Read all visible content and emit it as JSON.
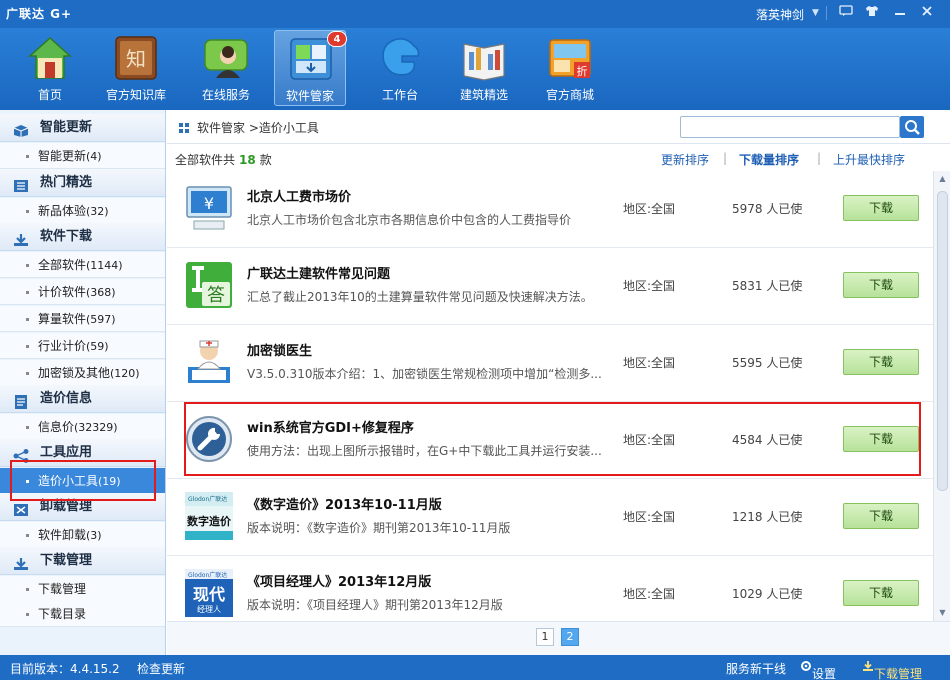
{
  "window": {
    "title": "广联达 G+",
    "user": "落英神剑",
    "controls": [
      "skin-icon",
      "shirt-icon",
      "minimize-icon",
      "close-icon"
    ]
  },
  "toolbar": {
    "items": [
      {
        "label": "首页",
        "icon": "home-icon"
      },
      {
        "label": "官方知识库",
        "icon": "knowledge-book-icon"
      },
      {
        "label": "在线服务",
        "icon": "online-service-icon"
      },
      {
        "label": "软件管家",
        "icon": "software-manager-icon",
        "active": true,
        "badge": "4"
      },
      {
        "label": "工作台",
        "icon": "workbench-icon"
      },
      {
        "label": "建筑精选",
        "icon": "architecture-book-icon"
      },
      {
        "label": "官方商城",
        "icon": "shop-icon"
      }
    ]
  },
  "sidebar": {
    "sections": [
      {
        "title": "智能更新",
        "icon": "cube-icon",
        "items": [
          {
            "label": "智能更新",
            "count": "(4)"
          }
        ]
      },
      {
        "title": "热门精选",
        "icon": "list-icon",
        "items": [
          {
            "label": "新品体验",
            "count": "(32)"
          }
        ]
      },
      {
        "title": "软件下载",
        "icon": "download-icon",
        "items": [
          {
            "label": "全部软件",
            "count": "(1144)"
          },
          {
            "label": "计价软件",
            "count": "(368)"
          },
          {
            "label": "算量软件",
            "count": "(597)"
          },
          {
            "label": "行业计价",
            "count": "(59)"
          },
          {
            "label": "加密锁及其他",
            "count": "(120)"
          }
        ]
      },
      {
        "title": "造价信息",
        "icon": "document-icon",
        "items": [
          {
            "label": "信息价",
            "count": "(32329)"
          }
        ]
      },
      {
        "title": "工具应用",
        "icon": "share-icon",
        "items": [
          {
            "label": "造价小工具",
            "count": "(19)",
            "selected": true
          }
        ]
      },
      {
        "title": "卸载管理",
        "icon": "uninstall-icon",
        "items": [
          {
            "label": "软件卸载",
            "count": "(3)"
          }
        ]
      },
      {
        "title": "下载管理",
        "icon": "download-manage-icon",
        "items": [
          {
            "label": "下载管理",
            "count": ""
          },
          {
            "label": "下载目录",
            "count": ""
          }
        ]
      }
    ]
  },
  "breadcrumb": {
    "root": "软件管家",
    "sep": ">",
    "current": "造价小工具"
  },
  "search": {
    "placeholder": "",
    "value": ""
  },
  "summary": {
    "prefix": "全部软件共",
    "count": "18",
    "suffix": "款"
  },
  "sort": {
    "newest": "更新排序",
    "downloads": "下载量排序",
    "rising": "上升最快排序"
  },
  "list": {
    "region_label": "地区:",
    "users_label": "人已使",
    "download_label": "下载",
    "rows": [
      {
        "name": "北京人工费市场价",
        "desc": "北京人工市场价包含北京市各期信息价中包含的人工费指导价",
        "region": "全国",
        "users": "5978",
        "icon": "computer-yen-icon"
      },
      {
        "name": "广联达土建软件常见问题",
        "desc": "汇总了截止2013年10的土建算量软件常见问题及快速解决方法。",
        "region": "全国",
        "users": "5831",
        "icon": "answer-icon"
      },
      {
        "name": "加密锁医生",
        "desc": "V3.5.0.310版本介绍：1、加密锁医生常规检测项中增加“检测多...",
        "region": "全国",
        "users": "5595",
        "icon": "doctor-icon"
      },
      {
        "name": "win系统官方GDI+修复程序",
        "desc": "使用方法：出现上图所示报错时，在G+中下载此工具并运行安装...",
        "region": "全国",
        "users": "4584",
        "icon": "wrench-icon"
      },
      {
        "name": "《数字造价》2013年10-11月版",
        "desc": "版本说明：《数字造价》期刊第2013年10-11月版",
        "region": "全国",
        "users": "1218",
        "icon": "magazine-digital-cost-icon"
      },
      {
        "name": "《项目经理人》2013年12月版",
        "desc": "版本说明：《项目经理人》期刊第2013年12月版",
        "region": "全国",
        "users": "1029",
        "icon": "magazine-project-manager-icon"
      }
    ]
  },
  "pagination": {
    "pages": [
      "1",
      "2"
    ],
    "current": "2"
  },
  "statusbar": {
    "version": "目前版本：4.4.15.2",
    "check_update": "检查更新",
    "server": "服务新干线",
    "settings": "设置",
    "download_manage": "下载管理"
  },
  "thumb_texts": {
    "answer": "答",
    "digital_cost": "数字造价",
    "project_manager_top": "现代",
    "project_manager_bottom": "经理人",
    "shop_tag": "折",
    "knowledge": "知",
    "glodon": "Glodon广联达"
  },
  "colors": {
    "titlebar": "#1e6cc4",
    "sidebar_bg": "#eaf2fb",
    "selected": "#3a88dc",
    "download_btn": "#b7e29a",
    "highlight_box": "#e41b1b",
    "count_green": "#2c9a22"
  }
}
